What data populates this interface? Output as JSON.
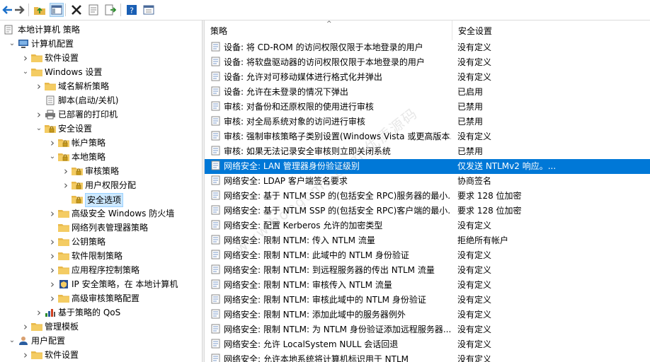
{
  "colors": {
    "selection": "#0078d7",
    "tree_selection": "#cce8ff",
    "folder": "#e8b84a"
  },
  "toolbar": {
    "buttons": [
      {
        "icon": "back-arrow-icon"
      },
      {
        "icon": "forward-arrow-icon"
      },
      {
        "icon": "up-folder-icon"
      },
      {
        "icon": "show-hide-tree-icon"
      },
      {
        "icon": "delete-icon"
      },
      {
        "icon": "properties-icon"
      },
      {
        "icon": "export-list-icon"
      },
      {
        "icon": "help-icon"
      },
      {
        "icon": "view-icon"
      }
    ]
  },
  "tree": {
    "items": [
      {
        "label": "本地计算机 策略",
        "indent": 0,
        "chevron": "",
        "icon": "computer-policy-icon"
      },
      {
        "label": "计算机配置",
        "indent": 1,
        "chevron": "v",
        "icon": "computer-icon"
      },
      {
        "label": "软件设置",
        "indent": 2,
        "chevron": ">",
        "icon": "folder-icon"
      },
      {
        "label": "Windows 设置",
        "indent": 2,
        "chevron": "v",
        "icon": "folder-icon"
      },
      {
        "label": "域名解析策略",
        "indent": 3,
        "chevron": ">",
        "icon": "folder-icon"
      },
      {
        "label": "脚本(启动/关机)",
        "indent": 3,
        "chevron": "",
        "icon": "script-icon"
      },
      {
        "label": "已部署的打印机",
        "indent": 3,
        "chevron": ">",
        "icon": "printer-icon"
      },
      {
        "label": "安全设置",
        "indent": 3,
        "chevron": "v",
        "icon": "security-folder-icon"
      },
      {
        "label": "帐户策略",
        "indent": 4,
        "chevron": ">",
        "icon": "security-folder-icon"
      },
      {
        "label": "本地策略",
        "indent": 4,
        "chevron": "v",
        "icon": "security-folder-icon"
      },
      {
        "label": "审核策略",
        "indent": 5,
        "chevron": ">",
        "icon": "security-folder-icon"
      },
      {
        "label": "用户权限分配",
        "indent": 5,
        "chevron": ">",
        "icon": "security-folder-icon"
      },
      {
        "label": "安全选项",
        "indent": 5,
        "chevron": "",
        "icon": "security-folder-icon",
        "selected": true
      },
      {
        "label": "高级安全 Windows 防火墙",
        "indent": 4,
        "chevron": ">",
        "icon": "folder-icon"
      },
      {
        "label": "网络列表管理器策略",
        "indent": 4,
        "chevron": "",
        "icon": "folder-icon"
      },
      {
        "label": "公钥策略",
        "indent": 4,
        "chevron": ">",
        "icon": "folder-icon"
      },
      {
        "label": "软件限制策略",
        "indent": 4,
        "chevron": ">",
        "icon": "folder-icon"
      },
      {
        "label": "应用程序控制策略",
        "indent": 4,
        "chevron": ">",
        "icon": "folder-icon"
      },
      {
        "label": "IP 安全策略，在 本地计算机",
        "indent": 4,
        "chevron": ">",
        "icon": "ip-security-icon"
      },
      {
        "label": "高级审核策略配置",
        "indent": 4,
        "chevron": ">",
        "icon": "folder-icon"
      },
      {
        "label": "基于策略的 QoS",
        "indent": 3,
        "chevron": ">",
        "icon": "qos-chart-icon"
      },
      {
        "label": "管理模板",
        "indent": 2,
        "chevron": ">",
        "icon": "folder-icon"
      },
      {
        "label": "用户配置",
        "indent": 1,
        "chevron": "v",
        "icon": "user-icon"
      },
      {
        "label": "软件设置",
        "indent": 2,
        "chevron": ">",
        "icon": "folder-icon"
      }
    ]
  },
  "list": {
    "col_policy": "策略",
    "col_setting": "安全设置",
    "rows": [
      {
        "policy": "设备: 将 CD-ROM 的访问权限仅限于本地登录的用户",
        "setting": "没有定义"
      },
      {
        "policy": "设备: 将软盘驱动器的访问权限仅限于本地登录的用户",
        "setting": "没有定义"
      },
      {
        "policy": "设备: 允许对可移动媒体进行格式化并弹出",
        "setting": "没有定义"
      },
      {
        "policy": "设备: 允许在未登录的情况下弹出",
        "setting": "已启用"
      },
      {
        "policy": "审核: 对备份和还原权限的使用进行审核",
        "setting": "已禁用"
      },
      {
        "policy": "审核: 对全局系统对象的访问进行审核",
        "setting": "已禁用"
      },
      {
        "policy": "审核: 强制审核策略子类别设置(Windows Vista 或更高版本...",
        "setting": "没有定义"
      },
      {
        "policy": "审核: 如果无法记录安全审核则立即关闭系统",
        "setting": "已禁用"
      },
      {
        "policy": "网络安全: LAN 管理器身份验证级别",
        "setting": "仅发送 NTLMv2 响应。...",
        "selected": true
      },
      {
        "policy": "网络安全: LDAP 客户端签名要求",
        "setting": "协商签名"
      },
      {
        "policy": "网络安全: 基于 NTLM SSP 的(包括安全 RPC)服务器的最小...",
        "setting": "要求 128 位加密"
      },
      {
        "policy": "网络安全: 基于 NTLM SSP 的(包括安全 RPC)客户端的最小...",
        "setting": "要求 128 位加密"
      },
      {
        "policy": "网络安全: 配置 Kerberos 允许的加密类型",
        "setting": "没有定义"
      },
      {
        "policy": "网络安全: 限制 NTLM: 传入 NTLM 流量",
        "setting": "拒绝所有帐户"
      },
      {
        "policy": "网络安全: 限制 NTLM: 此域中的 NTLM 身份验证",
        "setting": "没有定义"
      },
      {
        "policy": "网络安全: 限制 NTLM: 到远程服务器的传出 NTLM 流量",
        "setting": "没有定义"
      },
      {
        "policy": "网络安全: 限制 NTLM: 审核传入 NTLM 流量",
        "setting": "没有定义"
      },
      {
        "policy": "网络安全: 限制 NTLM: 审核此域中的 NTLM 身份验证",
        "setting": "没有定义"
      },
      {
        "policy": "网络安全: 限制 NTLM: 添加此域中的服务器例外",
        "setting": "没有定义"
      },
      {
        "policy": "网络安全: 限制 NTLM: 为 NTLM 身份验证添加远程服务器...",
        "setting": "没有定义"
      },
      {
        "policy": "网络安全: 允许 LocalSystem NULL 会话回退",
        "setting": "没有定义"
      },
      {
        "policy": "网络安全: 允许本地系统将计算机标识用于 NTLM",
        "setting": "没有定义"
      }
    ]
  },
  "watermark": "www.hongcms.com 优质源码"
}
